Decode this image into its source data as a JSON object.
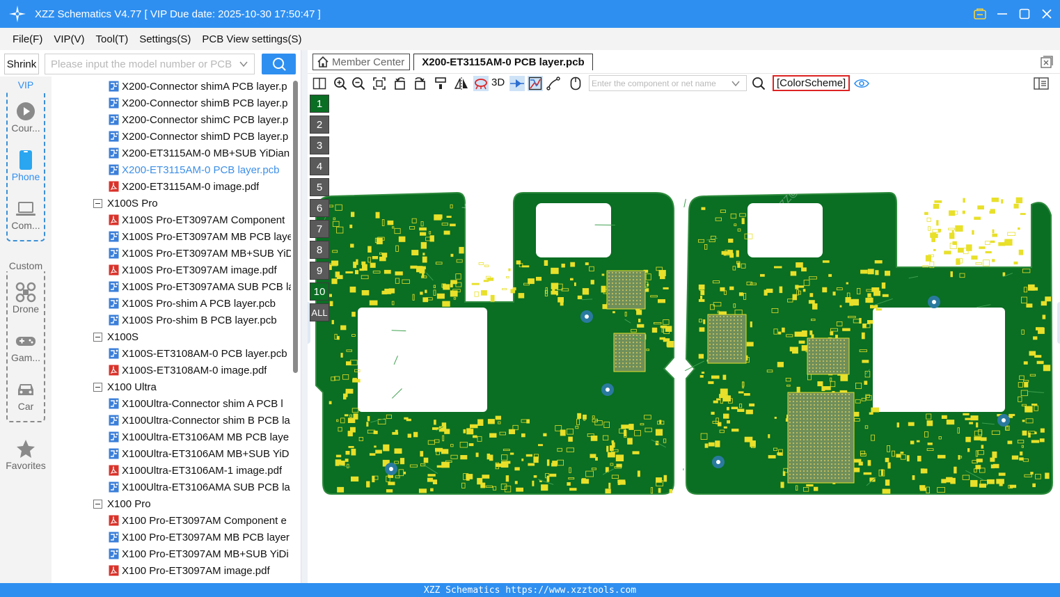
{
  "window": {
    "title": "XZZ Schematics V4.77 [ VIP Due date: 2025-10-30 17:50:47 ]"
  },
  "menu": [
    "File(F)",
    "VIP(V)",
    "Tool(T)",
    "Settings(S)",
    "PCB View settings(S)"
  ],
  "left": {
    "shrink_label": "Shrink",
    "search_placeholder": "Please input the model number or PCB"
  },
  "rail": {
    "vip_caption": "VIP",
    "custom_caption": "Custom",
    "items": [
      {
        "label": "Cour...",
        "icon": "play-circle-icon"
      },
      {
        "label": "Phone",
        "icon": "phone-icon"
      },
      {
        "label": "Com...",
        "icon": "laptop-icon"
      },
      {
        "label": "Drone",
        "icon": "drone-icon"
      },
      {
        "label": "Gam...",
        "icon": "gamepad-icon"
      },
      {
        "label": "Car",
        "icon": "car-icon"
      },
      {
        "label": "Favorites",
        "icon": "star-icon"
      }
    ]
  },
  "tree": [
    {
      "type": "file",
      "kind": "pcb",
      "label": "X200-Connector shimA PCB layer.p"
    },
    {
      "type": "file",
      "kind": "pcb",
      "label": "X200-Connector shimB PCB layer.p"
    },
    {
      "type": "file",
      "kind": "pcb",
      "label": "X200-Connector shimC PCB layer.p"
    },
    {
      "type": "file",
      "kind": "pcb",
      "label": "X200-Connector shimD PCB layer.p"
    },
    {
      "type": "file",
      "kind": "pcb",
      "label": "X200-ET3115AM-0 MB+SUB YiDian"
    },
    {
      "type": "file",
      "kind": "pcb",
      "label": "X200-ET3115AM-0 PCB layer.pcb",
      "selected": true
    },
    {
      "type": "file",
      "kind": "pdf",
      "label": "X200-ET3115AM-0 image.pdf"
    },
    {
      "type": "group",
      "label": "X100S Pro"
    },
    {
      "type": "file",
      "kind": "pdf",
      "label": "X100S Pro-ET3097AM Component"
    },
    {
      "type": "file",
      "kind": "pcb",
      "label": "X100S Pro-ET3097AM MB PCB laye"
    },
    {
      "type": "file",
      "kind": "pcb",
      "label": "X100S Pro-ET3097AM MB+SUB YiD"
    },
    {
      "type": "file",
      "kind": "pdf",
      "label": "X100S Pro-ET3097AM image.pdf"
    },
    {
      "type": "file",
      "kind": "pcb",
      "label": "X100S Pro-ET3097AMA SUB PCB la"
    },
    {
      "type": "file",
      "kind": "pcb",
      "label": "X100S Pro-shim A PCB layer.pcb"
    },
    {
      "type": "file",
      "kind": "pcb",
      "label": "X100S Pro-shim B PCB layer.pcb"
    },
    {
      "type": "group",
      "label": "X100S"
    },
    {
      "type": "file",
      "kind": "pcb",
      "label": "X100S-ET3108AM-0 PCB layer.pcb"
    },
    {
      "type": "file",
      "kind": "pdf",
      "label": "X100S-ET3108AM-0 image.pdf"
    },
    {
      "type": "group",
      "label": "X100 Ultra"
    },
    {
      "type": "file",
      "kind": "pcb",
      "label": "X100Ultra-Connector shim A PCB l"
    },
    {
      "type": "file",
      "kind": "pcb",
      "label": "X100Ultra-Connector shim B PCB la"
    },
    {
      "type": "file",
      "kind": "pcb",
      "label": "X100Ultra-ET3106AM MB PCB laye"
    },
    {
      "type": "file",
      "kind": "pcb",
      "label": "X100Ultra-ET3106AM MB+SUB YiD"
    },
    {
      "type": "file",
      "kind": "pdf",
      "label": "X100Ultra-ET3106AM-1 image.pdf"
    },
    {
      "type": "file",
      "kind": "pcb",
      "label": "X100Ultra-ET3106AMA SUB PCB la"
    },
    {
      "type": "group",
      "label": "X100 Pro"
    },
    {
      "type": "file",
      "kind": "pdf",
      "label": "X100 Pro-ET3097AM Component e"
    },
    {
      "type": "file",
      "kind": "pcb",
      "label": "X100 Pro-ET3097AM MB PCB layer"
    },
    {
      "type": "file",
      "kind": "pcb",
      "label": "X100 Pro-ET3097AM MB+SUB YiDi"
    },
    {
      "type": "file",
      "kind": "pdf",
      "label": "X100 Pro-ET3097AM image.pdf"
    }
  ],
  "tabs": {
    "member_center": "Member Center",
    "active_file": "X200-ET3115AM-0 PCB layer.pcb"
  },
  "toolbar": {
    "three_d_label": "3D",
    "component_placeholder": "Enter the component or net name",
    "color_scheme_label": "[ColorScheme]"
  },
  "layers": [
    "1",
    "2",
    "3",
    "4",
    "5",
    "6",
    "7",
    "8",
    "9",
    "10",
    "ALL"
  ],
  "active_layers": [
    "1",
    "10"
  ],
  "watermark_text": "XZZ@XZZHK",
  "status_text": "XZZ Schematics https://www.xzztools.com",
  "colors": {
    "accent": "#2f8ff0",
    "pcb_green": "#0a6e23",
    "pad_yellow": "#e8e02a",
    "pdf_red": "#d9332b"
  }
}
